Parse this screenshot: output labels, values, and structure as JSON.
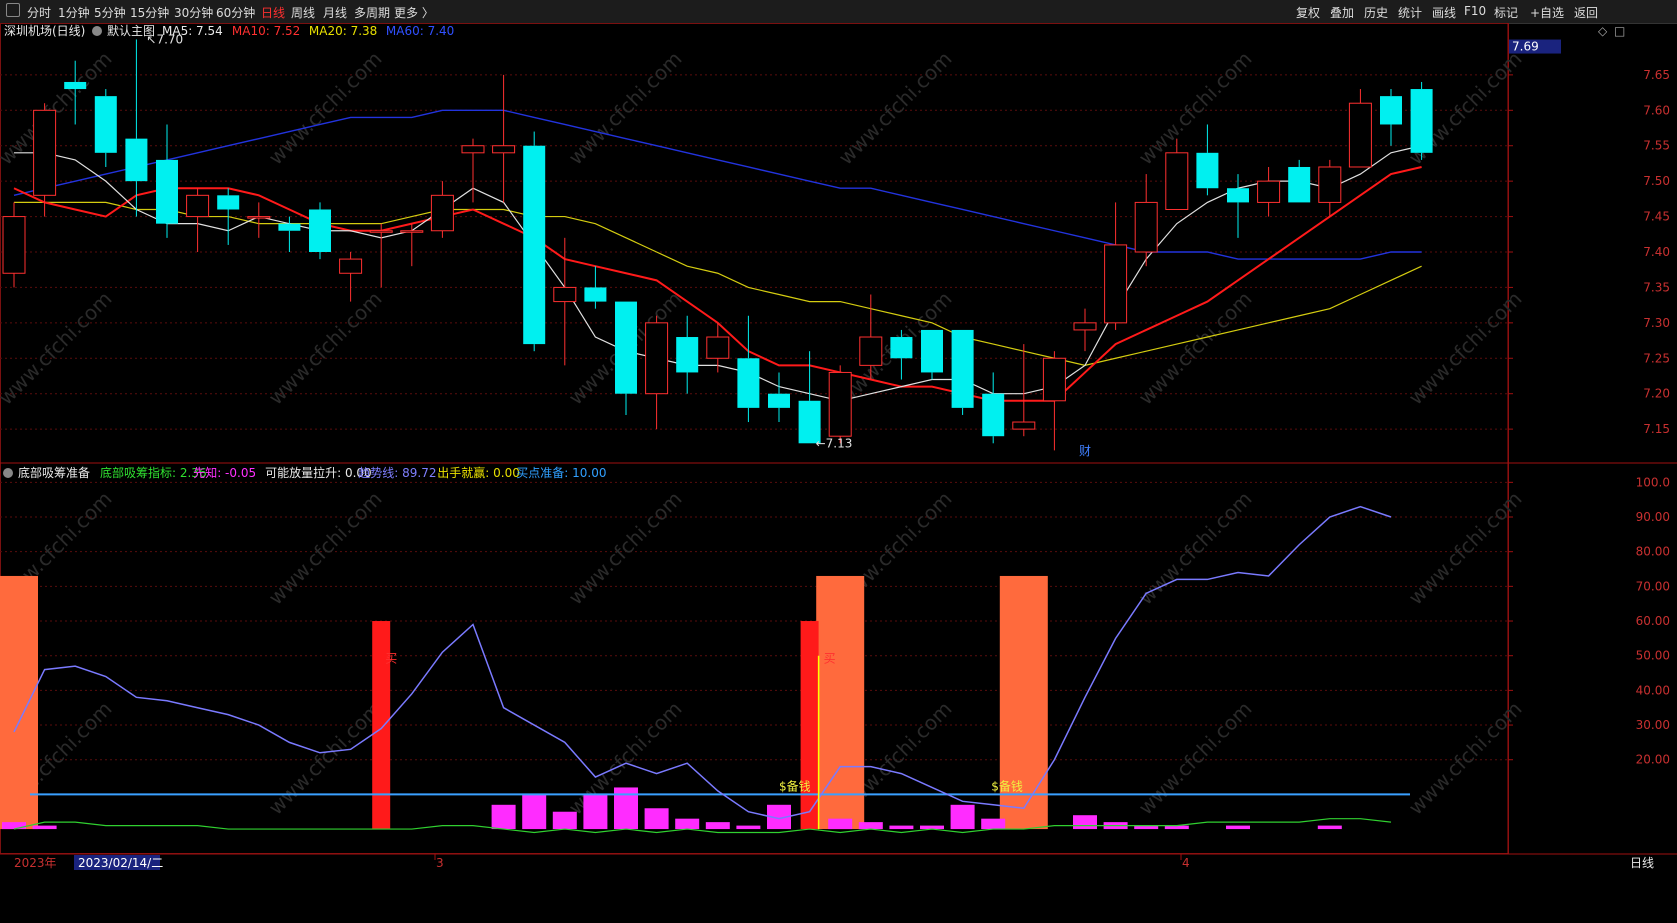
{
  "toolbar": {
    "tabs": [
      "分时",
      "1分钟",
      "5分钟",
      "15分钟",
      "30分钟",
      "60分钟",
      "日线",
      "周线",
      "月线",
      "多周期",
      "更多 〉"
    ],
    "active_tab": "日线",
    "right_buttons": [
      "复权",
      "叠加",
      "历史",
      "统计",
      "画线",
      "F10",
      "标记",
      "+自选",
      "返回"
    ]
  },
  "main_panel": {
    "stock_title": "深圳机场(日线)",
    "template": "默认主图",
    "ma_labels": [
      {
        "text": "MA5: 7.54",
        "color": "#e8e8e8"
      },
      {
        "text": "MA10: 7.52",
        "color": "#ff3030"
      },
      {
        "text": "MA20: 7.38",
        "color": "#e8e000"
      },
      {
        "text": "MA60: 7.40",
        "color": "#3050ff"
      }
    ],
    "current_price": "7.69",
    "high_annotation": "7.70",
    "low_annotation": "7.13",
    "event_marker": "财",
    "y_ticks": [
      "7.65",
      "7.60",
      "7.55",
      "7.50",
      "7.45",
      "7.40",
      "7.35",
      "7.30",
      "7.25",
      "7.20",
      "7.15"
    ]
  },
  "sub_panel": {
    "indicator_name": "底部吸筹准备",
    "labels": [
      {
        "text": "底部吸筹指标: 2.36",
        "color": "#30e030"
      },
      {
        "text": "先知: -0.05",
        "color": "#ff30ff"
      },
      {
        "text": "可能放量拉升: 0.00",
        "color": "#e8e8e8"
      },
      {
        "text": "趋势线: 89.72",
        "color": "#7f7fff"
      },
      {
        "text": "出手就赢: 0.00",
        "color": "#e8e000"
      },
      {
        "text": "买点准备: 10.00",
        "color": "#30a0ff"
      }
    ],
    "y_ticks": [
      "100.0",
      "90.00",
      "80.00",
      "70.00",
      "60.00",
      "50.00",
      "40.00",
      "30.00",
      "20.00"
    ],
    "annotations": {
      "buy": "买",
      "buy2": "买",
      "money1": "$备钱",
      "money2": "$备钱"
    }
  },
  "bottom_axis": {
    "year_label": "2023年",
    "cursor_date": "2023/02/14/二",
    "month_labels": [
      "3",
      "4"
    ],
    "period": "日线"
  },
  "watermark": "www.cfchi.com",
  "chart_data": {
    "type": "candlestick",
    "price_ylim": [
      7.105,
      7.695
    ],
    "candles": [
      {
        "o": 7.37,
        "c": 7.45,
        "h": 7.47,
        "l": 7.35
      },
      {
        "o": 7.48,
        "c": 7.6,
        "h": 7.61,
        "l": 7.45
      },
      {
        "o": 7.64,
        "c": 7.63,
        "h": 7.67,
        "l": 7.58
      },
      {
        "o": 7.62,
        "c": 7.54,
        "h": 7.63,
        "l": 7.52
      },
      {
        "o": 7.56,
        "c": 7.5,
        "h": 7.7,
        "l": 7.45
      },
      {
        "o": 7.53,
        "c": 7.44,
        "h": 7.58,
        "l": 7.42
      },
      {
        "o": 7.45,
        "c": 7.48,
        "h": 7.49,
        "l": 7.4
      },
      {
        "o": 7.48,
        "c": 7.46,
        "h": 7.49,
        "l": 7.41
      },
      {
        "o": 7.45,
        "c": 7.45,
        "h": 7.47,
        "l": 7.42
      },
      {
        "o": 7.44,
        "c": 7.43,
        "h": 7.45,
        "l": 7.4
      },
      {
        "o": 7.46,
        "c": 7.4,
        "h": 7.47,
        "l": 7.39
      },
      {
        "o": 7.37,
        "c": 7.39,
        "h": 7.4,
        "l": 7.33
      },
      {
        "o": 7.43,
        "c": 7.43,
        "h": 7.44,
        "l": 7.35
      },
      {
        "o": 7.43,
        "c": 7.43,
        "h": 7.44,
        "l": 7.38
      },
      {
        "o": 7.43,
        "c": 7.48,
        "h": 7.5,
        "l": 7.42
      },
      {
        "o": 7.54,
        "c": 7.55,
        "h": 7.56,
        "l": 7.47
      },
      {
        "o": 7.54,
        "c": 7.55,
        "h": 7.65,
        "l": 7.47
      },
      {
        "o": 7.55,
        "c": 7.27,
        "h": 7.57,
        "l": 7.26
      },
      {
        "o": 7.33,
        "c": 7.35,
        "h": 7.42,
        "l": 7.24
      },
      {
        "o": 7.35,
        "c": 7.33,
        "h": 7.38,
        "l": 7.32
      },
      {
        "o": 7.33,
        "c": 7.2,
        "h": 7.33,
        "l": 7.17
      },
      {
        "o": 7.2,
        "c": 7.3,
        "h": 7.31,
        "l": 7.15
      },
      {
        "o": 7.28,
        "c": 7.23,
        "h": 7.31,
        "l": 7.2
      },
      {
        "o": 7.25,
        "c": 7.28,
        "h": 7.3,
        "l": 7.23
      },
      {
        "o": 7.25,
        "c": 7.18,
        "h": 7.31,
        "l": 7.16
      },
      {
        "o": 7.2,
        "c": 7.18,
        "h": 7.23,
        "l": 7.16
      },
      {
        "o": 7.19,
        "c": 7.13,
        "h": 7.26,
        "l": 7.13
      },
      {
        "o": 7.14,
        "c": 7.23,
        "h": 7.24,
        "l": 7.13
      },
      {
        "o": 7.24,
        "c": 7.28,
        "h": 7.34,
        "l": 7.22
      },
      {
        "o": 7.28,
        "c": 7.25,
        "h": 7.29,
        "l": 7.22
      },
      {
        "o": 7.29,
        "c": 7.23,
        "h": 7.29,
        "l": 7.22
      },
      {
        "o": 7.29,
        "c": 7.18,
        "h": 7.29,
        "l": 7.17
      },
      {
        "o": 7.2,
        "c": 7.14,
        "h": 7.23,
        "l": 7.13
      },
      {
        "o": 7.15,
        "c": 7.16,
        "h": 7.27,
        "l": 7.14
      },
      {
        "o": 7.19,
        "c": 7.25,
        "h": 7.26,
        "l": 7.12
      },
      {
        "o": 7.29,
        "c": 7.3,
        "h": 7.32,
        "l": 7.26
      },
      {
        "o": 7.3,
        "c": 7.41,
        "h": 7.47,
        "l": 7.29
      },
      {
        "o": 7.4,
        "c": 7.47,
        "h": 7.51,
        "l": 7.38
      },
      {
        "o": 7.46,
        "c": 7.54,
        "h": 7.56,
        "l": 7.46
      },
      {
        "o": 7.54,
        "c": 7.49,
        "h": 7.58,
        "l": 7.48
      },
      {
        "o": 7.49,
        "c": 7.47,
        "h": 7.51,
        "l": 7.42
      },
      {
        "o": 7.47,
        "c": 7.5,
        "h": 7.52,
        "l": 7.45
      },
      {
        "o": 7.52,
        "c": 7.47,
        "h": 7.53,
        "l": 7.47
      },
      {
        "o": 7.47,
        "c": 7.52,
        "h": 7.53,
        "l": 7.45
      },
      {
        "o": 7.52,
        "c": 7.61,
        "h": 7.63,
        "l": 7.52
      },
      {
        "o": 7.62,
        "c": 7.58,
        "h": 7.63,
        "l": 7.55
      },
      {
        "o": 7.63,
        "c": 7.54,
        "h": 7.64,
        "l": 7.53
      }
    ],
    "ma5": [
      7.54,
      7.54,
      7.53,
      7.5,
      7.46,
      7.44,
      7.44,
      7.43,
      7.45,
      7.44,
      7.43,
      7.43,
      7.42,
      7.43,
      7.46,
      7.49,
      7.47,
      7.41,
      7.35,
      7.28,
      7.26,
      7.25,
      7.24,
      7.24,
      7.23,
      7.21,
      7.2,
      7.19,
      7.2,
      7.21,
      7.22,
      7.22,
      7.2,
      7.2,
      7.21,
      7.24,
      7.32,
      7.39,
      7.44,
      7.47,
      7.49,
      7.5,
      7.5,
      7.49,
      7.51,
      7.54,
      7.55
    ],
    "ma10": [
      7.49,
      7.47,
      7.46,
      7.45,
      7.48,
      7.49,
      7.49,
      7.49,
      7.48,
      7.46,
      7.44,
      7.43,
      7.43,
      7.44,
      7.45,
      7.46,
      7.44,
      7.42,
      7.39,
      7.38,
      7.37,
      7.36,
      7.33,
      7.3,
      7.26,
      7.24,
      7.24,
      7.23,
      7.22,
      7.21,
      7.21,
      7.2,
      7.19,
      7.19,
      7.19,
      7.23,
      7.27,
      7.29,
      7.31,
      7.33,
      7.36,
      7.39,
      7.42,
      7.45,
      7.48,
      7.51,
      7.52
    ],
    "ma20": [
      7.47,
      7.47,
      7.47,
      7.47,
      7.46,
      7.46,
      7.45,
      7.45,
      7.44,
      7.44,
      7.44,
      7.44,
      7.44,
      7.45,
      7.46,
      7.46,
      7.46,
      7.45,
      7.45,
      7.44,
      7.42,
      7.4,
      7.38,
      7.37,
      7.35,
      7.34,
      7.33,
      7.33,
      7.32,
      7.31,
      7.3,
      7.28,
      7.27,
      7.26,
      7.25,
      7.24,
      7.25,
      7.26,
      7.27,
      7.28,
      7.29,
      7.3,
      7.31,
      7.32,
      7.34,
      7.36,
      7.38
    ],
    "ma60": [
      7.48,
      7.49,
      7.5,
      7.51,
      7.52,
      7.53,
      7.54,
      7.55,
      7.56,
      7.57,
      7.58,
      7.59,
      7.59,
      7.59,
      7.6,
      7.6,
      7.6,
      7.59,
      7.58,
      7.57,
      7.56,
      7.55,
      7.54,
      7.53,
      7.52,
      7.51,
      7.5,
      7.49,
      7.49,
      7.48,
      7.47,
      7.46,
      7.45,
      7.44,
      7.43,
      7.42,
      7.41,
      7.4,
      7.4,
      7.4,
      7.39,
      7.39,
      7.39,
      7.39,
      7.39,
      7.4,
      7.4
    ],
    "indicator_ylim": [
      -2,
      105
    ],
    "trend_line": [
      28,
      46,
      47,
      44,
      38,
      37,
      35,
      33,
      30,
      25,
      22,
      23,
      29,
      39,
      51,
      59,
      35,
      30,
      25,
      15,
      19,
      16,
      19,
      11,
      5,
      3,
      5,
      18,
      18,
      16,
      12,
      8,
      7,
      6,
      20,
      38,
      55,
      68,
      72,
      72,
      74,
      73,
      82,
      90,
      93,
      90
    ],
    "buy_ready": 10,
    "magenta_bars": [
      2,
      1,
      0,
      0,
      0,
      0,
      0,
      0,
      0,
      0,
      0,
      0,
      0,
      0,
      0,
      0,
      7,
      10,
      5,
      10,
      12,
      6,
      3,
      2,
      1,
      7,
      0,
      3,
      2,
      1,
      1,
      7,
      3,
      0,
      0,
      4,
      2,
      1,
      1,
      0,
      1,
      0,
      0,
      1,
      0,
      0
    ],
    "green_line": [
      0,
      2,
      2,
      1,
      1,
      1,
      1,
      0,
      0,
      0,
      0,
      0,
      0,
      0,
      1,
      1,
      0,
      -1,
      0,
      -1,
      0,
      -1,
      0,
      -1,
      -1,
      -1,
      0,
      -1,
      0,
      -1,
      0,
      -1,
      0,
      0,
      1,
      1,
      1,
      1,
      1,
      2,
      2,
      2,
      2,
      3,
      3,
      2
    ],
    "orange_bars_index": [
      0,
      27,
      33
    ],
    "orange_value": 73,
    "red_bars_index": [
      12,
      26
    ],
    "red_value": 60
  }
}
